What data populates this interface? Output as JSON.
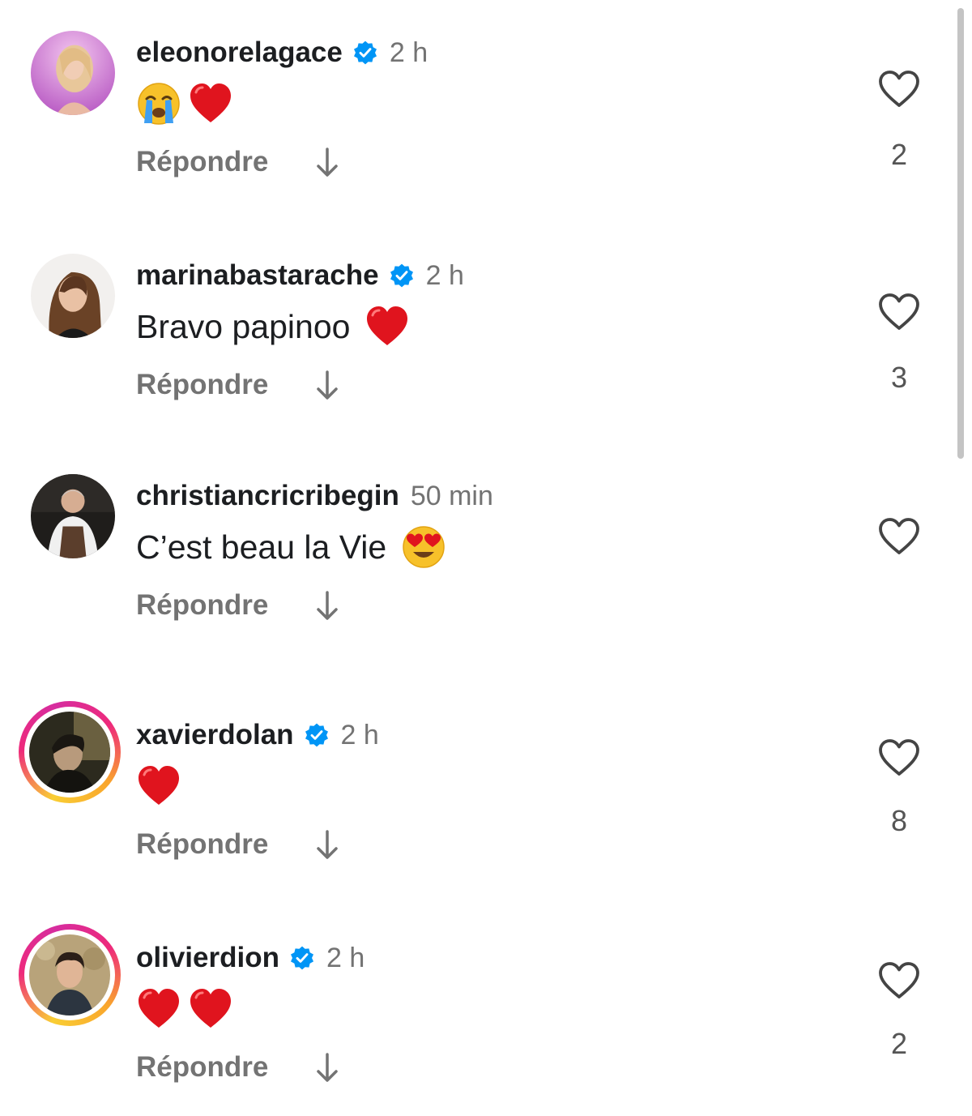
{
  "comments": [
    {
      "username": "eleonorelagace",
      "verified": true,
      "time": "2 h",
      "text": "",
      "emojis": [
        "crying-face",
        "red-heart"
      ],
      "reply_label": "Répondre",
      "likes": "2",
      "avatar": "woman-blonde-pink-bg",
      "story_ring": false
    },
    {
      "username": "marinabastarache",
      "verified": true,
      "time": "2 h",
      "text": "Bravo papinoo",
      "emojis": [
        "red-heart"
      ],
      "reply_label": "Répondre",
      "likes": "3",
      "avatar": "woman-brunette",
      "story_ring": false
    },
    {
      "username": "christiancricribegin",
      "verified": false,
      "time": "50 min",
      "text": "C’est beau la Vie",
      "emojis": [
        "heart-eyes-face"
      ],
      "reply_label": "Répondre",
      "likes": "",
      "avatar": "man-chef-apron",
      "story_ring": false
    },
    {
      "username": "xavierdolan",
      "verified": true,
      "time": "2 h",
      "text": "",
      "emojis": [
        "red-heart"
      ],
      "reply_label": "Répondre",
      "likes": "8",
      "avatar": "man-dark-portrait",
      "story_ring": true
    },
    {
      "username": "olivierdion",
      "verified": true,
      "time": "2 h",
      "text": "",
      "emojis": [
        "red-heart",
        "red-heart"
      ],
      "reply_label": "Répondre",
      "likes": "2",
      "avatar": "man-curly-hair",
      "story_ring": true
    }
  ],
  "colors": {
    "verified_blue": "#0095f6",
    "secondary_text": "#737373",
    "heart_red": "#e0141e"
  }
}
